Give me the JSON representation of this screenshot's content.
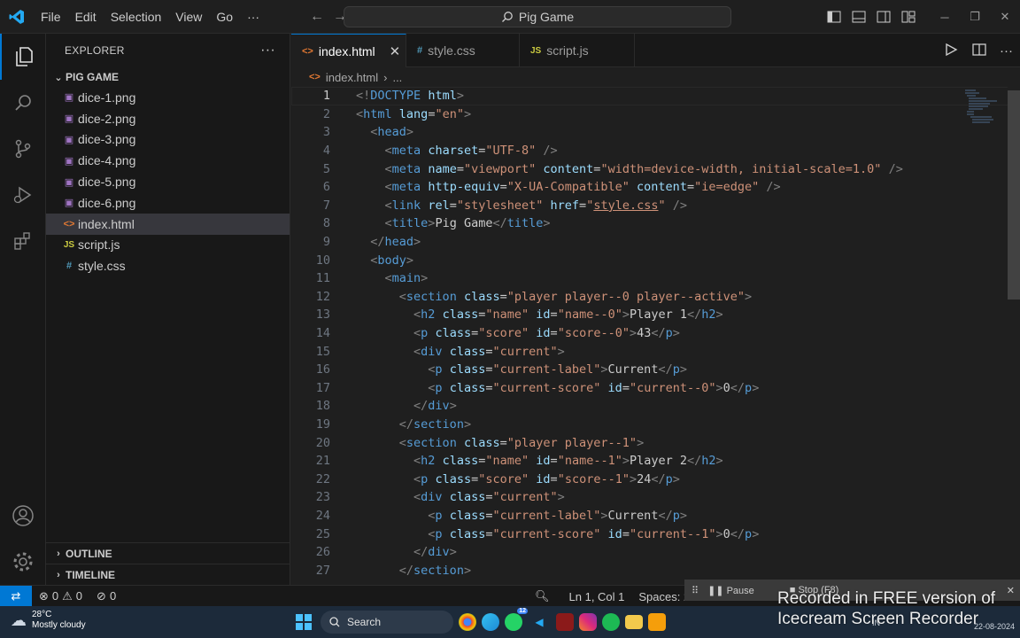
{
  "window": {
    "search_text": "Pig Game"
  },
  "menu": [
    "File",
    "Edit",
    "Selection",
    "View",
    "Go",
    "···"
  ],
  "sidebar": {
    "header": "EXPLORER",
    "folder": "PIG GAME",
    "files": [
      {
        "name": "dice-1.png",
        "type": "img"
      },
      {
        "name": "dice-2.png",
        "type": "img"
      },
      {
        "name": "dice-3.png",
        "type": "img"
      },
      {
        "name": "dice-4.png",
        "type": "img"
      },
      {
        "name": "dice-5.png",
        "type": "img"
      },
      {
        "name": "dice-6.png",
        "type": "img"
      },
      {
        "name": "index.html",
        "type": "html"
      },
      {
        "name": "script.js",
        "type": "js"
      },
      {
        "name": "style.css",
        "type": "css"
      }
    ],
    "outline": "OUTLINE",
    "timeline": "TIMELINE"
  },
  "tabs": [
    {
      "label": "index.html",
      "icon": "<>",
      "active": true
    },
    {
      "label": "style.css",
      "icon": "#",
      "active": false
    },
    {
      "label": "script.js",
      "icon": "JS",
      "active": false
    }
  ],
  "breadcrumb": {
    "file": "index.html",
    "more": "..."
  },
  "code_lines": [
    {
      "n": "1",
      "html": "<span class='t-br'>&lt;!</span><span class='t-tag'>DOCTYPE</span> <span class='t-attr'>html</span><span class='t-br'>&gt;</span>"
    },
    {
      "n": "2",
      "html": "<span class='t-br'>&lt;</span><span class='t-tag'>html</span> <span class='t-attr'>lang</span>=<span class='t-str'>\"en\"</span><span class='t-br'>&gt;</span>"
    },
    {
      "n": "3",
      "html": "  <span class='t-br'>&lt;</span><span class='t-tag'>head</span><span class='t-br'>&gt;</span>"
    },
    {
      "n": "4",
      "html": "    <span class='t-br'>&lt;</span><span class='t-tag'>meta</span> <span class='t-attr'>charset</span>=<span class='t-str'>\"UTF-8\"</span> <span class='t-br'>/&gt;</span>"
    },
    {
      "n": "5",
      "html": "    <span class='t-br'>&lt;</span><span class='t-tag'>meta</span> <span class='t-attr'>name</span>=<span class='t-str'>\"viewport\"</span> <span class='t-attr'>content</span>=<span class='t-str'>\"width=device-width, initial-scale=1.0\"</span> <span class='t-br'>/&gt;</span>"
    },
    {
      "n": "6",
      "html": "    <span class='t-br'>&lt;</span><span class='t-tag'>meta</span> <span class='t-attr'>http-equiv</span>=<span class='t-str'>\"X-UA-Compatible\"</span> <span class='t-attr'>content</span>=<span class='t-str'>\"ie=edge\"</span> <span class='t-br'>/&gt;</span>"
    },
    {
      "n": "7",
      "html": "    <span class='t-br'>&lt;</span><span class='t-tag'>link</span> <span class='t-attr'>rel</span>=<span class='t-str'>\"stylesheet\"</span> <span class='t-attr'>href</span>=<span class='t-str'>\"<span class='t-link'>style.css</span>\"</span> <span class='t-br'>/&gt;</span>"
    },
    {
      "n": "8",
      "html": "    <span class='t-br'>&lt;</span><span class='t-tag'>title</span><span class='t-br'>&gt;</span><span class='t-txt'>Pig Game</span><span class='t-br'>&lt;/</span><span class='t-tag'>title</span><span class='t-br'>&gt;</span>"
    },
    {
      "n": "9",
      "html": "  <span class='t-br'>&lt;/</span><span class='t-tag'>head</span><span class='t-br'>&gt;</span>"
    },
    {
      "n": "10",
      "html": "  <span class='t-br'>&lt;</span><span class='t-tag'>body</span><span class='t-br'>&gt;</span>"
    },
    {
      "n": "11",
      "html": "    <span class='t-br'>&lt;</span><span class='t-tag'>main</span><span class='t-br'>&gt;</span>"
    },
    {
      "n": "12",
      "html": "      <span class='t-br'>&lt;</span><span class='t-tag'>section</span> <span class='t-attr'>class</span>=<span class='t-str'>\"player player--0 player--active\"</span><span class='t-br'>&gt;</span>"
    },
    {
      "n": "13",
      "html": "        <span class='t-br'>&lt;</span><span class='t-tag'>h2</span> <span class='t-attr'>class</span>=<span class='t-str'>\"name\"</span> <span class='t-attr'>id</span>=<span class='t-str'>\"name--0\"</span><span class='t-br'>&gt;</span><span class='t-txt'>Player 1</span><span class='t-br'>&lt;/</span><span class='t-tag'>h2</span><span class='t-br'>&gt;</span>"
    },
    {
      "n": "14",
      "html": "        <span class='t-br'>&lt;</span><span class='t-tag'>p</span> <span class='t-attr'>class</span>=<span class='t-str'>\"score\"</span> <span class='t-attr'>id</span>=<span class='t-str'>\"score--0\"</span><span class='t-br'>&gt;</span><span class='t-txt'>43</span><span class='t-br'>&lt;/</span><span class='t-tag'>p</span><span class='t-br'>&gt;</span>"
    },
    {
      "n": "15",
      "html": "        <span class='t-br'>&lt;</span><span class='t-tag'>div</span> <span class='t-attr'>class</span>=<span class='t-str'>\"current\"</span><span class='t-br'>&gt;</span>"
    },
    {
      "n": "16",
      "html": "          <span class='t-br'>&lt;</span><span class='t-tag'>p</span> <span class='t-attr'>class</span>=<span class='t-str'>\"current-label\"</span><span class='t-br'>&gt;</span><span class='t-txt'>Current</span><span class='t-br'>&lt;/</span><span class='t-tag'>p</span><span class='t-br'>&gt;</span>"
    },
    {
      "n": "17",
      "html": "          <span class='t-br'>&lt;</span><span class='t-tag'>p</span> <span class='t-attr'>class</span>=<span class='t-str'>\"current-score\"</span> <span class='t-attr'>id</span>=<span class='t-str'>\"current--0\"</span><span class='t-br'>&gt;</span><span class='t-txt'>0</span><span class='t-br'>&lt;/</span><span class='t-tag'>p</span><span class='t-br'>&gt;</span>"
    },
    {
      "n": "18",
      "html": "        <span class='t-br'>&lt;/</span><span class='t-tag'>div</span><span class='t-br'>&gt;</span>"
    },
    {
      "n": "19",
      "html": "      <span class='t-br'>&lt;/</span><span class='t-tag'>section</span><span class='t-br'>&gt;</span>"
    },
    {
      "n": "20",
      "html": "      <span class='t-br'>&lt;</span><span class='t-tag'>section</span> <span class='t-attr'>class</span>=<span class='t-str'>\"player player--1\"</span><span class='t-br'>&gt;</span>"
    },
    {
      "n": "21",
      "html": "        <span class='t-br'>&lt;</span><span class='t-tag'>h2</span> <span class='t-attr'>class</span>=<span class='t-str'>\"name\"</span> <span class='t-attr'>id</span>=<span class='t-str'>\"name--1\"</span><span class='t-br'>&gt;</span><span class='t-txt'>Player 2</span><span class='t-br'>&lt;/</span><span class='t-tag'>h2</span><span class='t-br'>&gt;</span>"
    },
    {
      "n": "22",
      "html": "        <span class='t-br'>&lt;</span><span class='t-tag'>p</span> <span class='t-attr'>class</span>=<span class='t-str'>\"score\"</span> <span class='t-attr'>id</span>=<span class='t-str'>\"score--1\"</span><span class='t-br'>&gt;</span><span class='t-txt'>24</span><span class='t-br'>&lt;/</span><span class='t-tag'>p</span><span class='t-br'>&gt;</span>"
    },
    {
      "n": "23",
      "html": "        <span class='t-br'>&lt;</span><span class='t-tag'>div</span> <span class='t-attr'>class</span>=<span class='t-str'>\"current\"</span><span class='t-br'>&gt;</span>"
    },
    {
      "n": "24",
      "html": "          <span class='t-br'>&lt;</span><span class='t-tag'>p</span> <span class='t-attr'>class</span>=<span class='t-str'>\"current-label\"</span><span class='t-br'>&gt;</span><span class='t-txt'>Current</span><span class='t-br'>&lt;/</span><span class='t-tag'>p</span><span class='t-br'>&gt;</span>"
    },
    {
      "n": "25",
      "html": "          <span class='t-br'>&lt;</span><span class='t-tag'>p</span> <span class='t-attr'>class</span>=<span class='t-str'>\"current-score\"</span> <span class='t-attr'>id</span>=<span class='t-str'>\"current--1\"</span><span class='t-br'>&gt;</span><span class='t-txt'>0</span><span class='t-br'>&lt;/</span><span class='t-tag'>p</span><span class='t-br'>&gt;</span>"
    },
    {
      "n": "26",
      "html": "        <span class='t-br'>&lt;/</span><span class='t-tag'>div</span><span class='t-br'>&gt;</span>"
    },
    {
      "n": "27",
      "html": "      <span class='t-br'>&lt;/</span><span class='t-tag'>section</span><span class='t-br'>&gt;</span>"
    }
  ],
  "statusbar": {
    "errors": "0",
    "warnings": "0",
    "ports": "0",
    "position": "Ln 1, Col 1",
    "spaces": "Spaces: 2"
  },
  "recorder": {
    "pause": "Pause",
    "stop": "Stop (F8)"
  },
  "taskbar": {
    "temp": "28°C",
    "weather": "Mostly cloudy",
    "search": "Search",
    "badge": "12",
    "lang": "IN",
    "date": "22-08-2024"
  },
  "watermark": "Recorded in FREE version of Icecream Screen Recorder",
  "colors": {
    "accent": "#0078d4",
    "tag": "#569cd6",
    "attr": "#9cdcfe",
    "string": "#ce9178"
  }
}
